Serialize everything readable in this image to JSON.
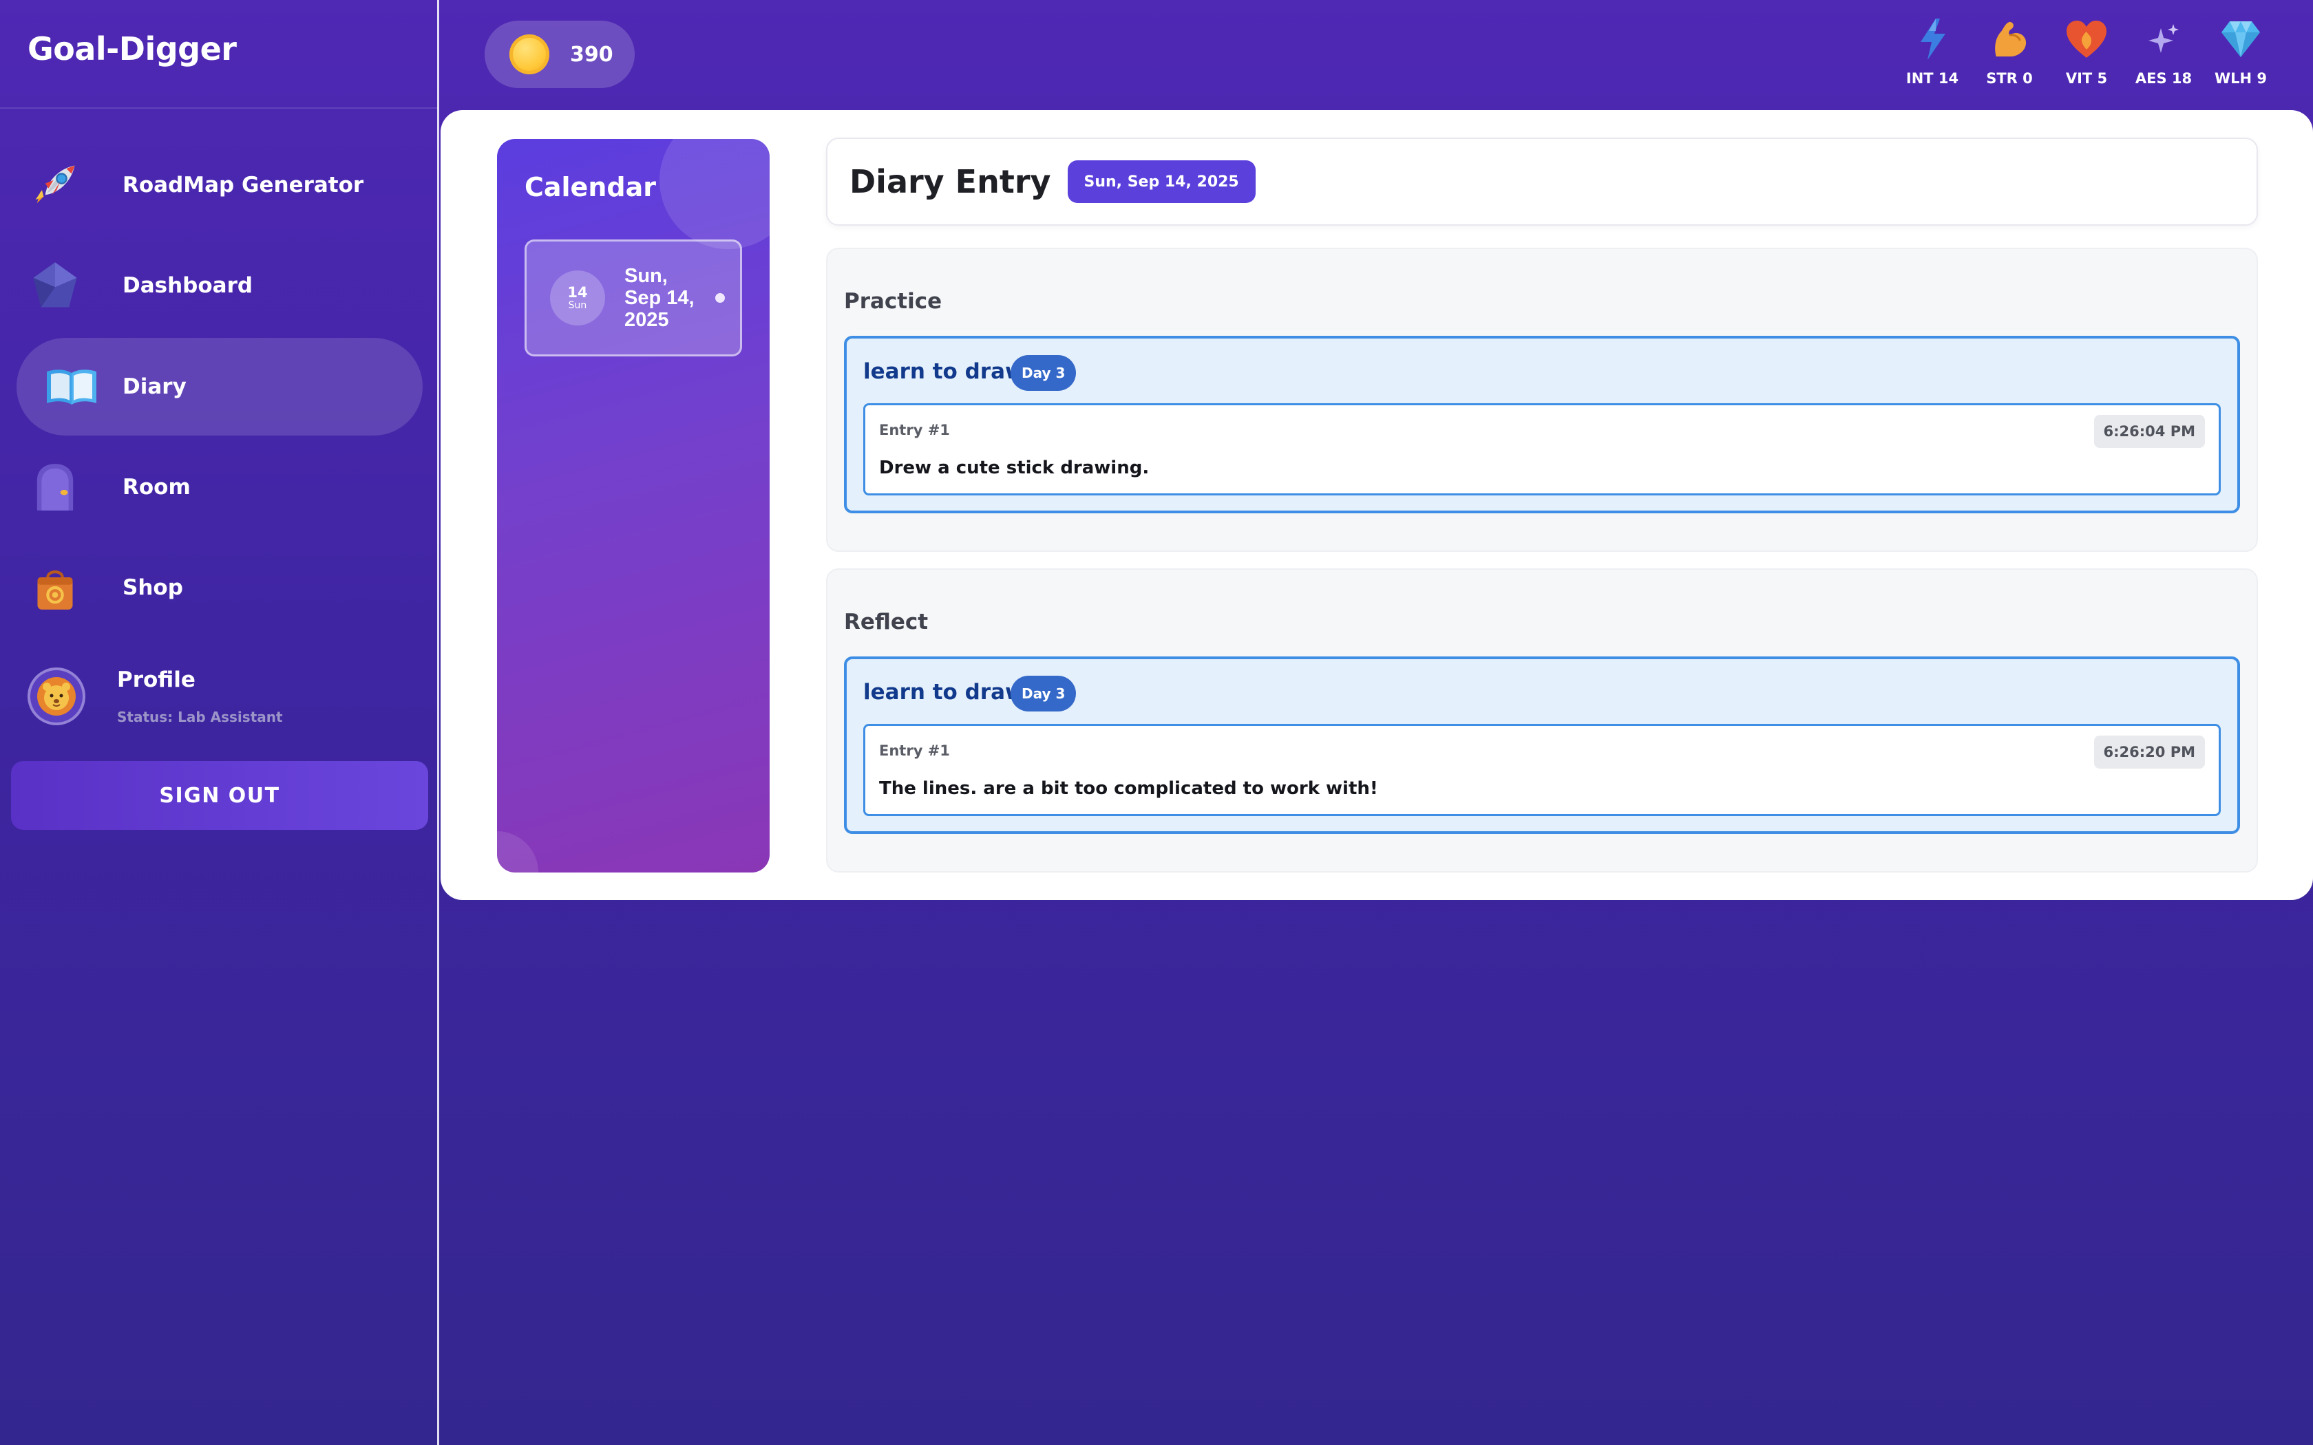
{
  "app": {
    "title": "Goal-Digger"
  },
  "sidebar": {
    "items": [
      {
        "label": "RoadMap Generator",
        "icon": "rocket-icon"
      },
      {
        "label": "Dashboard",
        "icon": "pentagon-gem-icon"
      },
      {
        "label": "Diary",
        "icon": "open-book-icon",
        "active": true
      },
      {
        "label": "Room",
        "icon": "door-icon"
      },
      {
        "label": "Shop",
        "icon": "shopping-bag-icon"
      }
    ],
    "profile": {
      "label": "Profile",
      "status": "Status: Lab Assistant",
      "icon": "lion-avatar-icon"
    },
    "signout_label": "SIGN OUT"
  },
  "topbar": {
    "coins": "390",
    "coin_icon": "coin-icon",
    "stats": [
      {
        "label": "INT 14",
        "icon": "lightning-icon",
        "color": "#3b7de0"
      },
      {
        "label": "STR 0",
        "icon": "flexed-biceps-icon",
        "color": "#f2a03a"
      },
      {
        "label": "VIT 5",
        "icon": "heart-icon",
        "color": "#e8542f"
      },
      {
        "label": "AES 18",
        "icon": "sparkles-icon",
        "color": "#b4a8ee"
      },
      {
        "label": "WLH 9",
        "icon": "diamond-icon",
        "color": "#4fb9ef"
      }
    ]
  },
  "calendar": {
    "title": "Calendar",
    "days": [
      {
        "num": "14",
        "dow": "Sun",
        "date": "Sun, Sep 14, 2025"
      }
    ]
  },
  "diary": {
    "title": "Diary Entry",
    "date_badge": "Sun, Sep 14, 2025",
    "sections": [
      {
        "title": "Practice",
        "goal": "learn to draw",
        "day": "Day 3",
        "entry_num": "Entry #1",
        "time": "6:26:04 PM",
        "text": "Drew a cute stick drawing."
      },
      {
        "title": "Reflect",
        "goal": "learn to draw",
        "day": "Day 3",
        "entry_num": "Entry #1",
        "time": "6:26:20 PM",
        "text": "The lines. are a bit too complicated to work with!"
      }
    ]
  },
  "colors": {
    "background": "#4f28b4",
    "accent": "#5b40dc",
    "goal_border": "#3d8ee4",
    "goal_title": "#123a8c"
  }
}
